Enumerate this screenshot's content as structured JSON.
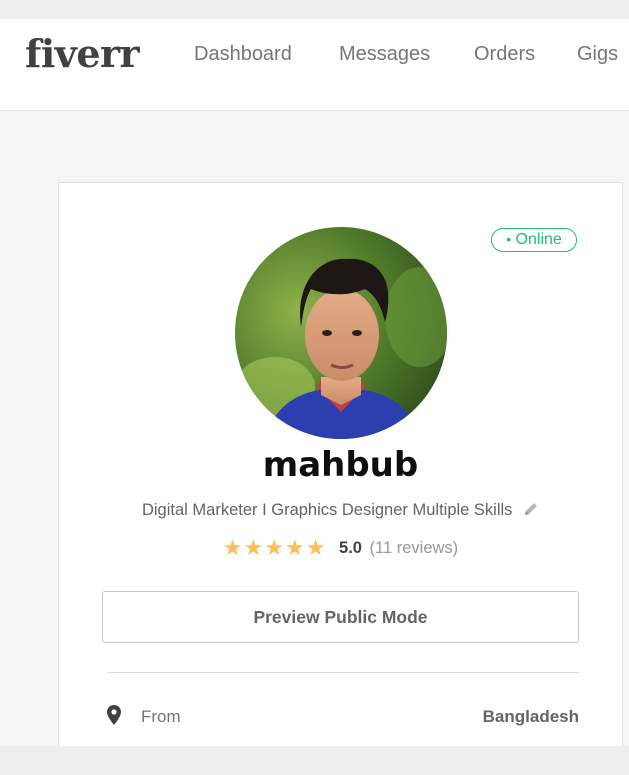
{
  "header": {
    "logo": "fiverr",
    "nav": [
      "Dashboard",
      "Messages",
      "Orders",
      "Gigs"
    ]
  },
  "profile": {
    "status": "Online",
    "username": "mahbub",
    "tagline": "Digital Marketer I Graphics Designer Multiple Skills",
    "stars": "★★★★★",
    "rating_value": 5.0,
    "rating_text": "5.0",
    "reviews_text": "(11 reviews)",
    "preview_button": "Preview Public Mode",
    "from_label": "From",
    "country": "Bangladesh"
  },
  "colors": {
    "brand_text": "#404145",
    "online_green": "#1dbf73",
    "star_yellow": "#ffbe5b"
  },
  "icons": [
    "pencil-icon",
    "location-pin-icon",
    "online-dot-icon",
    "star-icon"
  ]
}
